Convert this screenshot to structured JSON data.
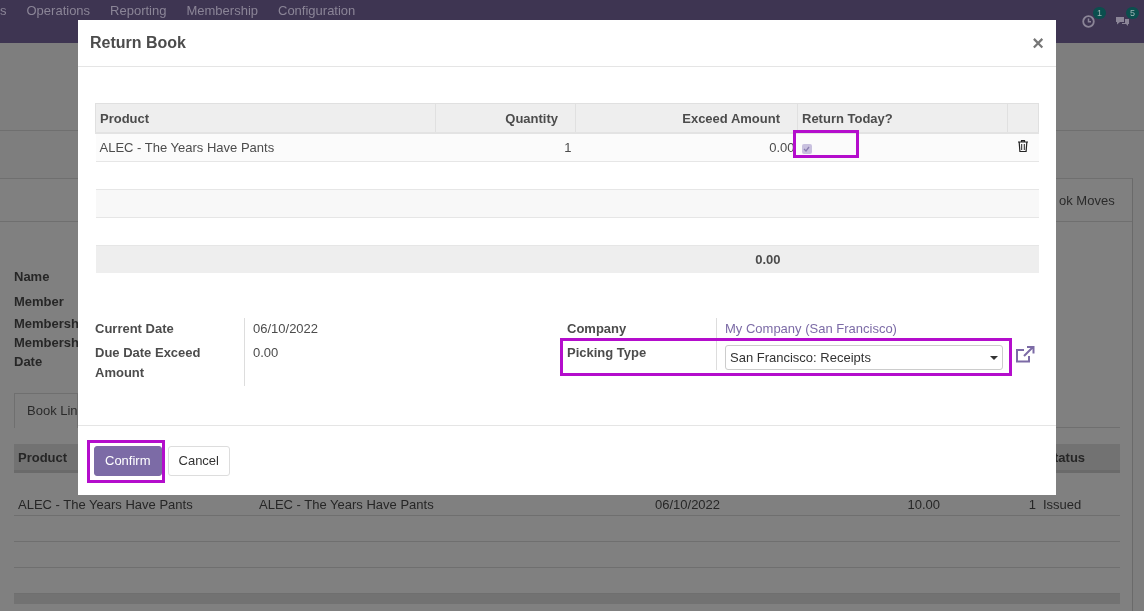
{
  "navbar": {
    "menu": [
      "s",
      "Operations",
      "Reporting",
      "Membership",
      "Configuration"
    ],
    "activity_badge": "1",
    "message_badge": "5"
  },
  "background": {
    "stat_button": "ok Moves",
    "labels": [
      "Name",
      "Member",
      "Membersh",
      "Membersh",
      "Date"
    ],
    "tab": "Book Lin",
    "table": {
      "columns": [
        "Product",
        "",
        "",
        "",
        "",
        "tatus"
      ],
      "rows": [
        {
          "cells": [
            "ALEC - The Years Have Pants",
            "ALEC - The Years Have Pants",
            "06/10/2022",
            "10.00",
            "1",
            "Issued"
          ]
        }
      ]
    }
  },
  "dialog": {
    "title": "Return Book",
    "close": "×",
    "table": {
      "columns": [
        "Product",
        "Quantity",
        "Exceed Amount",
        "Return Today?"
      ],
      "rows": [
        {
          "product": "ALEC - The Years Have Pants",
          "quantity": "1",
          "exceed_amount": "0.00",
          "return_today": true,
          "highlighted": true
        }
      ],
      "total": "0.00"
    },
    "fields_left": [
      {
        "label": "Current Date",
        "value": "06/10/2022"
      },
      {
        "label": "Due Date Exceed Amount",
        "value": "0.00"
      }
    ],
    "fields_right": [
      {
        "label": "Company",
        "value": "My Company (San Francisco)",
        "kind": "link",
        "highlighted": false
      },
      {
        "label": "Picking Type",
        "value": "San Francisco: Receipts",
        "kind": "select",
        "highlighted": true
      }
    ],
    "buttons": [
      {
        "label": "Confirm",
        "kind": "primary",
        "highlighted": true
      },
      {
        "label": "Cancel",
        "kind": "secondary",
        "highlighted": false
      }
    ]
  }
}
